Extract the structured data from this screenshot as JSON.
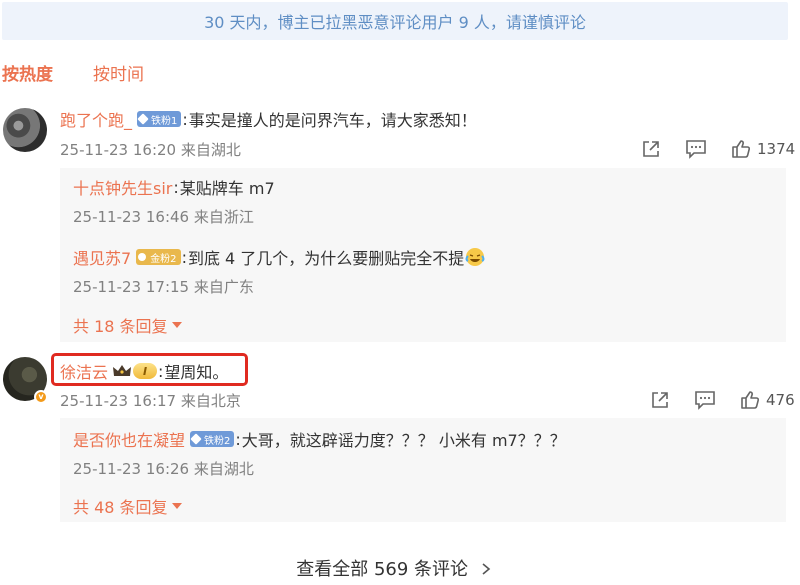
{
  "notice": "30 天内，博主已拉黑恶意评论用户 9 人，请谨慎评论",
  "sort": {
    "hot": "按热度",
    "time": "按时间"
  },
  "comments": [
    {
      "user": "跑了个跑_",
      "badge": "铁粉1",
      "text": "事实是撞人的是问界汽车，请大家悉知！",
      "meta": "25-11-23 16:20 来自湖北",
      "likes": "1374",
      "replies": [
        {
          "user": "十点钟先生sir",
          "text": "某贴牌车 m7",
          "meta": "25-11-23 16:46 来自浙江"
        },
        {
          "user": "遇见苏7",
          "badge": "金粉2",
          "text": "到底 4 了几个，为什么要删贴完全不提",
          "meta": "25-11-23 17:15 来自广东"
        }
      ],
      "more": "共 18 条回复"
    },
    {
      "user": "徐洁云",
      "vip": "I",
      "text": "望周知。",
      "meta": "25-11-23 16:17 来自北京",
      "likes": "476",
      "replies": [
        {
          "user": "是否你也在凝望",
          "badge": "铁粉2",
          "text": "大哥，就这辟谣力度？？？ 小米有 m7？？？",
          "meta": "25-11-23 16:26 来自湖北"
        }
      ],
      "more": "共 48 条回复"
    }
  ],
  "footer": "查看全部 569 条评论",
  "icons": [
    "share-icon",
    "comment-icon",
    "like-icon",
    "chevron-right-icon",
    "verified-v-icon",
    "laugh-cry-emoji-icon",
    "crown-icon"
  ],
  "colors": {
    "username": "#eb7350",
    "notice_bg": "#eef3fb",
    "notice_text": "#5f8ec4",
    "highlight": "#e02a20"
  }
}
